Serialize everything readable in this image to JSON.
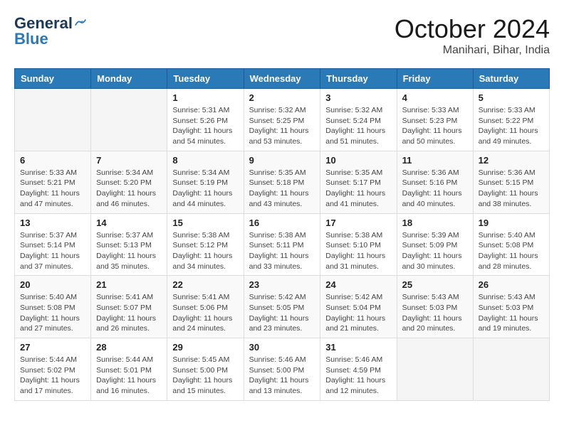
{
  "header": {
    "logo": {
      "general": "General",
      "blue": "Blue"
    },
    "title": "October 2024",
    "location": "Manihari, Bihar, India"
  },
  "calendar": {
    "days_of_week": [
      "Sunday",
      "Monday",
      "Tuesday",
      "Wednesday",
      "Thursday",
      "Friday",
      "Saturday"
    ],
    "weeks": [
      [
        {
          "day": "",
          "info": ""
        },
        {
          "day": "",
          "info": ""
        },
        {
          "day": "1",
          "info": "Sunrise: 5:31 AM\nSunset: 5:26 PM\nDaylight: 11 hours and 54 minutes."
        },
        {
          "day": "2",
          "info": "Sunrise: 5:32 AM\nSunset: 5:25 PM\nDaylight: 11 hours and 53 minutes."
        },
        {
          "day": "3",
          "info": "Sunrise: 5:32 AM\nSunset: 5:24 PM\nDaylight: 11 hours and 51 minutes."
        },
        {
          "day": "4",
          "info": "Sunrise: 5:33 AM\nSunset: 5:23 PM\nDaylight: 11 hours and 50 minutes."
        },
        {
          "day": "5",
          "info": "Sunrise: 5:33 AM\nSunset: 5:22 PM\nDaylight: 11 hours and 49 minutes."
        }
      ],
      [
        {
          "day": "6",
          "info": "Sunrise: 5:33 AM\nSunset: 5:21 PM\nDaylight: 11 hours and 47 minutes."
        },
        {
          "day": "7",
          "info": "Sunrise: 5:34 AM\nSunset: 5:20 PM\nDaylight: 11 hours and 46 minutes."
        },
        {
          "day": "8",
          "info": "Sunrise: 5:34 AM\nSunset: 5:19 PM\nDaylight: 11 hours and 44 minutes."
        },
        {
          "day": "9",
          "info": "Sunrise: 5:35 AM\nSunset: 5:18 PM\nDaylight: 11 hours and 43 minutes."
        },
        {
          "day": "10",
          "info": "Sunrise: 5:35 AM\nSunset: 5:17 PM\nDaylight: 11 hours and 41 minutes."
        },
        {
          "day": "11",
          "info": "Sunrise: 5:36 AM\nSunset: 5:16 PM\nDaylight: 11 hours and 40 minutes."
        },
        {
          "day": "12",
          "info": "Sunrise: 5:36 AM\nSunset: 5:15 PM\nDaylight: 11 hours and 38 minutes."
        }
      ],
      [
        {
          "day": "13",
          "info": "Sunrise: 5:37 AM\nSunset: 5:14 PM\nDaylight: 11 hours and 37 minutes."
        },
        {
          "day": "14",
          "info": "Sunrise: 5:37 AM\nSunset: 5:13 PM\nDaylight: 11 hours and 35 minutes."
        },
        {
          "day": "15",
          "info": "Sunrise: 5:38 AM\nSunset: 5:12 PM\nDaylight: 11 hours and 34 minutes."
        },
        {
          "day": "16",
          "info": "Sunrise: 5:38 AM\nSunset: 5:11 PM\nDaylight: 11 hours and 33 minutes."
        },
        {
          "day": "17",
          "info": "Sunrise: 5:38 AM\nSunset: 5:10 PM\nDaylight: 11 hours and 31 minutes."
        },
        {
          "day": "18",
          "info": "Sunrise: 5:39 AM\nSunset: 5:09 PM\nDaylight: 11 hours and 30 minutes."
        },
        {
          "day": "19",
          "info": "Sunrise: 5:40 AM\nSunset: 5:08 PM\nDaylight: 11 hours and 28 minutes."
        }
      ],
      [
        {
          "day": "20",
          "info": "Sunrise: 5:40 AM\nSunset: 5:08 PM\nDaylight: 11 hours and 27 minutes."
        },
        {
          "day": "21",
          "info": "Sunrise: 5:41 AM\nSunset: 5:07 PM\nDaylight: 11 hours and 26 minutes."
        },
        {
          "day": "22",
          "info": "Sunrise: 5:41 AM\nSunset: 5:06 PM\nDaylight: 11 hours and 24 minutes."
        },
        {
          "day": "23",
          "info": "Sunrise: 5:42 AM\nSunset: 5:05 PM\nDaylight: 11 hours and 23 minutes."
        },
        {
          "day": "24",
          "info": "Sunrise: 5:42 AM\nSunset: 5:04 PM\nDaylight: 11 hours and 21 minutes."
        },
        {
          "day": "25",
          "info": "Sunrise: 5:43 AM\nSunset: 5:03 PM\nDaylight: 11 hours and 20 minutes."
        },
        {
          "day": "26",
          "info": "Sunrise: 5:43 AM\nSunset: 5:03 PM\nDaylight: 11 hours and 19 minutes."
        }
      ],
      [
        {
          "day": "27",
          "info": "Sunrise: 5:44 AM\nSunset: 5:02 PM\nDaylight: 11 hours and 17 minutes."
        },
        {
          "day": "28",
          "info": "Sunrise: 5:44 AM\nSunset: 5:01 PM\nDaylight: 11 hours and 16 minutes."
        },
        {
          "day": "29",
          "info": "Sunrise: 5:45 AM\nSunset: 5:00 PM\nDaylight: 11 hours and 15 minutes."
        },
        {
          "day": "30",
          "info": "Sunrise: 5:46 AM\nSunset: 5:00 PM\nDaylight: 11 hours and 13 minutes."
        },
        {
          "day": "31",
          "info": "Sunrise: 5:46 AM\nSunset: 4:59 PM\nDaylight: 11 hours and 12 minutes."
        },
        {
          "day": "",
          "info": ""
        },
        {
          "day": "",
          "info": ""
        }
      ]
    ]
  }
}
